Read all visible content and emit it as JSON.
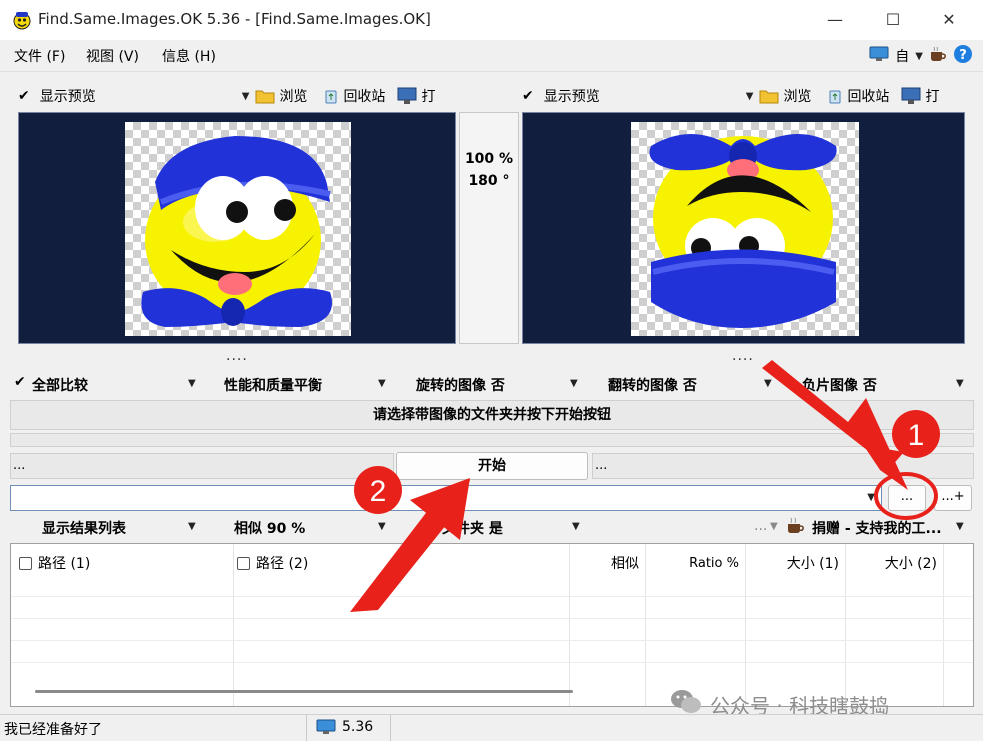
{
  "window": {
    "title": "Find.Same.Images.OK 5.36 - [Find.Same.Images.OK]",
    "minimize": "—",
    "maximize": "☐",
    "close": "✕"
  },
  "menu": {
    "file": "文件 (F)",
    "view": "视图 (V)",
    "info": "信息 (H)",
    "right_label": "自"
  },
  "left_pane": {
    "show_preview": "显示预览",
    "browse": "浏览",
    "recycle": "回收站",
    "open": "打"
  },
  "right_pane": {
    "show_preview": "显示预览",
    "browse": "浏览",
    "recycle": "回收站",
    "open": "打"
  },
  "center_info": {
    "similarity": "100 %",
    "rotation": "180 °"
  },
  "splitter_dots": "....",
  "options": {
    "compare_all": "全部比较",
    "balance": "性能和质量平衡",
    "rotated": "旋转的图像 否",
    "flipped": "翻转的图像 否",
    "negative": "负片图像 否"
  },
  "hint": "请选择带图像的文件夹并按下开始按钮",
  "left_field": "...",
  "start_button": "开始",
  "right_field": "...",
  "folder_input": "",
  "browse_button": "...",
  "add_button": "...+",
  "results_options": {
    "show_list": "显示结果列表",
    "similar": "相似 90 %",
    "subfolders": "子文件夹 是",
    "more": "...",
    "donate": "捐赠 - 支持我的工..."
  },
  "columns": {
    "path1": "路径 (1)",
    "path2": "路径 (2)",
    "similar": "相似",
    "ratio": "Ratio %",
    "size1": "大小 (1)",
    "size2": "大小 (2)"
  },
  "status": {
    "ready": "我已经准备好了",
    "version": "5.36"
  },
  "watermark": "公众号 · 科技瞎鼓捣",
  "annotations": {
    "marker1": "1",
    "marker2": "2",
    "color": "#e8211b"
  }
}
